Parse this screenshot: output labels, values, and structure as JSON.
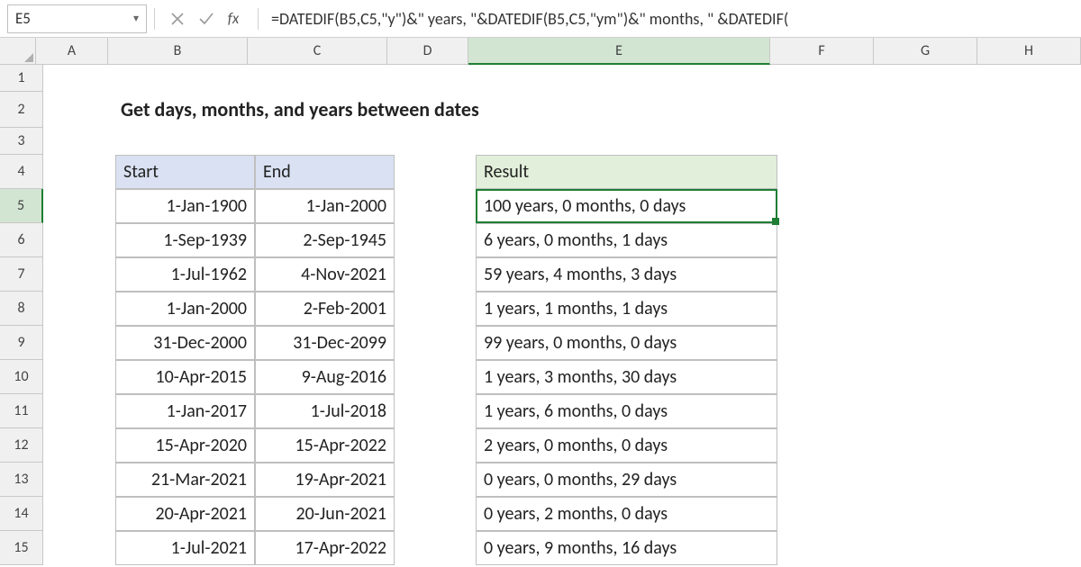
{
  "cell_ref": "E5",
  "formula": "=DATEDIF(B5,C5,\"y\")&\" years, \"&DATEDIF(B5,C5,\"ym\")&\" months, \" &DATEDIF(",
  "title": "Get days, months, and years between dates",
  "headers": {
    "start": "Start",
    "end": "End",
    "result": "Result"
  },
  "cols": [
    "A",
    "B",
    "C",
    "D",
    "E",
    "F",
    "G",
    "H"
  ],
  "rownums": [
    "1",
    "2",
    "3",
    "4",
    "5",
    "6",
    "7",
    "8",
    "9",
    "10",
    "11",
    "12",
    "13",
    "14",
    "15"
  ],
  "rows": [
    {
      "start": "1-Jan-1900",
      "end": "1-Jan-2000",
      "result": "100 years, 0 months, 0 days"
    },
    {
      "start": "1-Sep-1939",
      "end": "2-Sep-1945",
      "result": "6 years, 0 months, 1 days"
    },
    {
      "start": "1-Jul-1962",
      "end": "4-Nov-2021",
      "result": "59 years, 4 months, 3 days"
    },
    {
      "start": "1-Jan-2000",
      "end": "2-Feb-2001",
      "result": "1 years, 1 months, 1 days"
    },
    {
      "start": "31-Dec-2000",
      "end": "31-Dec-2099",
      "result": "99 years, 0 months, 0 days"
    },
    {
      "start": "10-Apr-2015",
      "end": "9-Aug-2016",
      "result": "1 years, 3 months, 30 days"
    },
    {
      "start": "1-Jan-2017",
      "end": "1-Jul-2018",
      "result": "1 years, 6 months, 0 days"
    },
    {
      "start": "15-Apr-2020",
      "end": "15-Apr-2022",
      "result": "2 years, 0 months, 0 days"
    },
    {
      "start": "21-Mar-2021",
      "end": "19-Apr-2021",
      "result": "0 years, 0 months, 29 days"
    },
    {
      "start": "20-Apr-2021",
      "end": "20-Jun-2021",
      "result": "0 years, 2 months, 0 days"
    },
    {
      "start": "1-Jul-2021",
      "end": "17-Apr-2022",
      "result": "0 years, 9 months, 16 days"
    }
  ]
}
